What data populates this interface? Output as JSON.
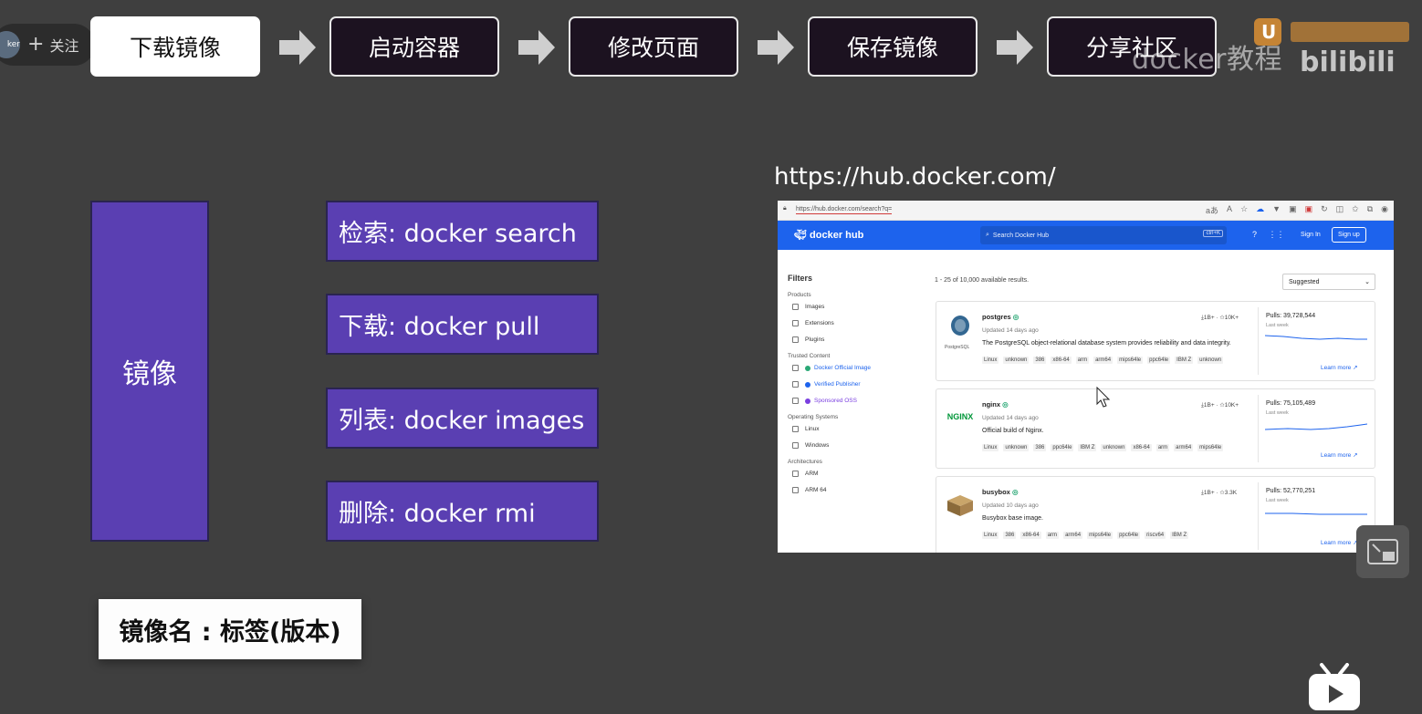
{
  "follow": {
    "avatar_text": "ker",
    "label": "关注"
  },
  "steps": [
    {
      "label": "下载镜像",
      "active": true
    },
    {
      "label": "启动容器",
      "active": false
    },
    {
      "label": "修改页面",
      "active": false
    },
    {
      "label": "保存镜像",
      "active": false
    },
    {
      "label": "分享社区",
      "active": false
    }
  ],
  "watermark": {
    "text": "docker教程",
    "brand": "bilibili"
  },
  "diagram": {
    "image_label": "镜像",
    "commands": [
      "检索:  docker search",
      "下载:  docker pull",
      "列表:  docker images",
      "删除:  docker rmi"
    ],
    "tag_format": "镜像名 : 标签(版本)"
  },
  "hub_url": "https://hub.docker.com/",
  "browser": {
    "address": "https://hub.docker.com/search?q=",
    "logo_text": "docker hub",
    "search_placeholder": "Search Docker Hub",
    "search_shortcut": "ctrl+K",
    "sign_in": "Sign In",
    "sign_up": "Sign up",
    "filters_title": "Filters",
    "filter_sections": {
      "products": "Products",
      "trusted": "Trusted Content",
      "os": "Operating Systems",
      "arch": "Architectures"
    },
    "filter_options": {
      "images": "Images",
      "extensions": "Extensions",
      "plugins": "Plugins",
      "official": "Docker Official Image",
      "verified": "Verified Publisher",
      "sponsored": "Sponsored OSS",
      "linux": "Linux",
      "windows": "Windows",
      "arm": "ARM",
      "arm64": "ARM 64"
    },
    "results_count": "1 - 25 of 10,000 available results.",
    "sort_value": "Suggested",
    "results": [
      {
        "name": "postgres",
        "logo": "PostgreSQL",
        "updated": "Updated 14 days ago",
        "description": "The PostgreSQL object-relational database system provides reliability and data integrity.",
        "tags": [
          "Linux",
          "unknown",
          "386",
          "x86-64",
          "arm",
          "arm64",
          "mips64le",
          "ppc64le",
          "IBM Z",
          "unknown"
        ],
        "stats": "⤓1B+ · ☆10K+",
        "pulls": "Pulls: 39,728,544",
        "period": "Last week",
        "learn_more": "Learn more"
      },
      {
        "name": "nginx",
        "logo": "NGINX",
        "updated": "Updated 14 days ago",
        "description": "Official build of Nginx.",
        "tags": [
          "Linux",
          "unknown",
          "386",
          "ppc64le",
          "IBM Z",
          "unknown",
          "x86-64",
          "arm",
          "arm64",
          "mips64le"
        ],
        "stats": "⤓1B+ · ☆10K+",
        "pulls": "Pulls: 75,105,489",
        "period": "Last week",
        "learn_more": "Learn more"
      },
      {
        "name": "busybox",
        "logo": "",
        "updated": "Updated 10 days ago",
        "description": "Busybox base image.",
        "tags": [
          "Linux",
          "386",
          "x86-64",
          "arm",
          "arm64",
          "mips64le",
          "ppc64le",
          "riscv64",
          "IBM Z"
        ],
        "stats": "⤓1B+ · ☆3.3K",
        "pulls": "Pulls: 52,770,251",
        "period": "Last week",
        "learn_more": "Learn more"
      }
    ]
  }
}
